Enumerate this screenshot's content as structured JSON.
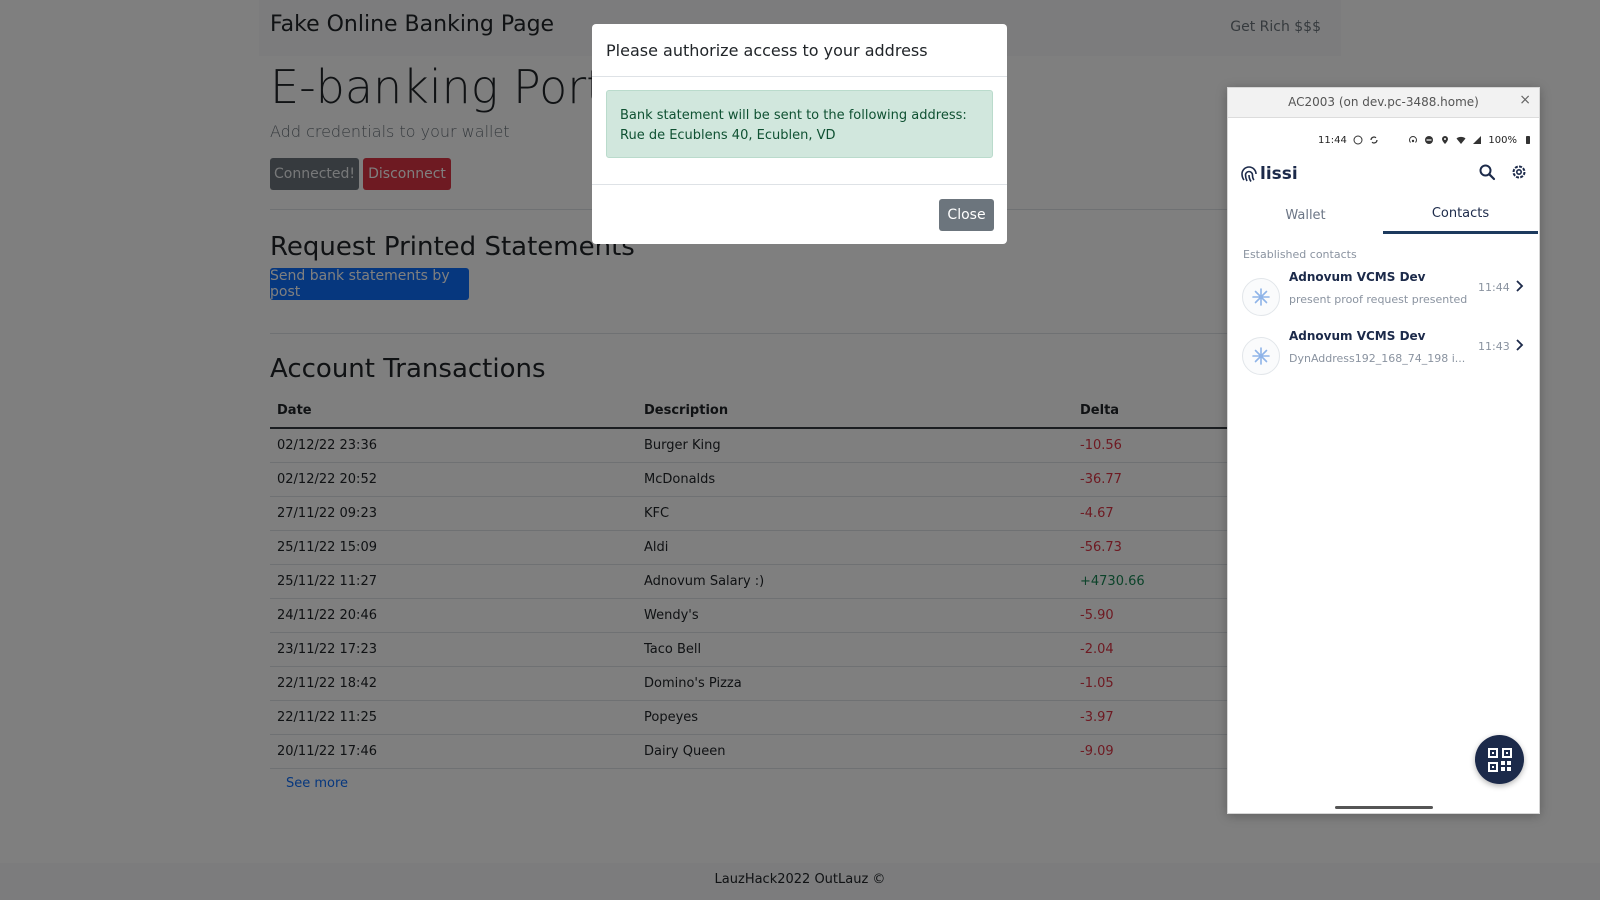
{
  "navbar": {
    "brand": "Fake Online Banking Page",
    "link": "Get Rich $$$"
  },
  "hero": {
    "title": "E-banking Portal",
    "lead": "Add credentials to your wallet",
    "connected_label": "Connected!",
    "disconnect_label": "Disconnect"
  },
  "statements": {
    "title": "Request Printed Statements",
    "button_label": "Send bank statements by post"
  },
  "transactions": {
    "title": "Account Transactions",
    "headers": {
      "date": "Date",
      "description": "Description",
      "delta": "Delta"
    },
    "rows": [
      {
        "date": "02/12/22 23:36",
        "description": "Burger King",
        "delta": "-10.56",
        "sign": "neg"
      },
      {
        "date": "02/12/22 20:52",
        "description": "McDonalds",
        "delta": "-36.77",
        "sign": "neg"
      },
      {
        "date": "27/11/22 09:23",
        "description": "KFC",
        "delta": "-4.67",
        "sign": "neg"
      },
      {
        "date": "25/11/22 15:09",
        "description": "Aldi",
        "delta": "-56.73",
        "sign": "neg"
      },
      {
        "date": "25/11/22 11:27",
        "description": "Adnovum Salary :)",
        "delta": "+4730.66",
        "sign": "pos"
      },
      {
        "date": "24/11/22 20:46",
        "description": "Wendy's",
        "delta": "-5.90",
        "sign": "neg"
      },
      {
        "date": "23/11/22 17:23",
        "description": "Taco Bell",
        "delta": "-2.04",
        "sign": "neg"
      },
      {
        "date": "22/11/22 18:42",
        "description": "Domino's Pizza",
        "delta": "-1.05",
        "sign": "neg"
      },
      {
        "date": "22/11/22 11:25",
        "description": "Popeyes",
        "delta": "-3.97",
        "sign": "neg"
      },
      {
        "date": "20/11/22 17:46",
        "description": "Dairy Queen",
        "delta": "-9.09",
        "sign": "neg"
      }
    ],
    "see_more": "See more"
  },
  "footer": {
    "text": "LauzHack2022 OutLauz ©"
  },
  "modal": {
    "title": "Please authorize access to your address",
    "alert_line1": "Bank statement will be sent to the following address:",
    "alert_line2": "Rue de Ecublens 40, Ecublen, VD",
    "close_label": "Close"
  },
  "phone": {
    "window_title": "AC2003 (on dev.pc-3488.home)",
    "window_close": "×",
    "status": {
      "time": "11:44",
      "battery": "100%"
    },
    "app_name": "lissi",
    "tabs": {
      "wallet": "Wallet",
      "contacts": "Contacts"
    },
    "section_label": "Established contacts",
    "contacts": [
      {
        "name": "Adnovum VCMS Dev",
        "subtitle": "present proof request presented",
        "time": "11:44"
      },
      {
        "name": "Adnovum VCMS Dev",
        "subtitle": "DynAddress192_168_74_198 i...",
        "time": "11:43"
      }
    ]
  },
  "colors": {
    "primary": "#0d6efd",
    "danger": "#dc3545",
    "success": "#198754",
    "secondary": "#6c757d",
    "lissi_navy": "#1c2a4a"
  }
}
